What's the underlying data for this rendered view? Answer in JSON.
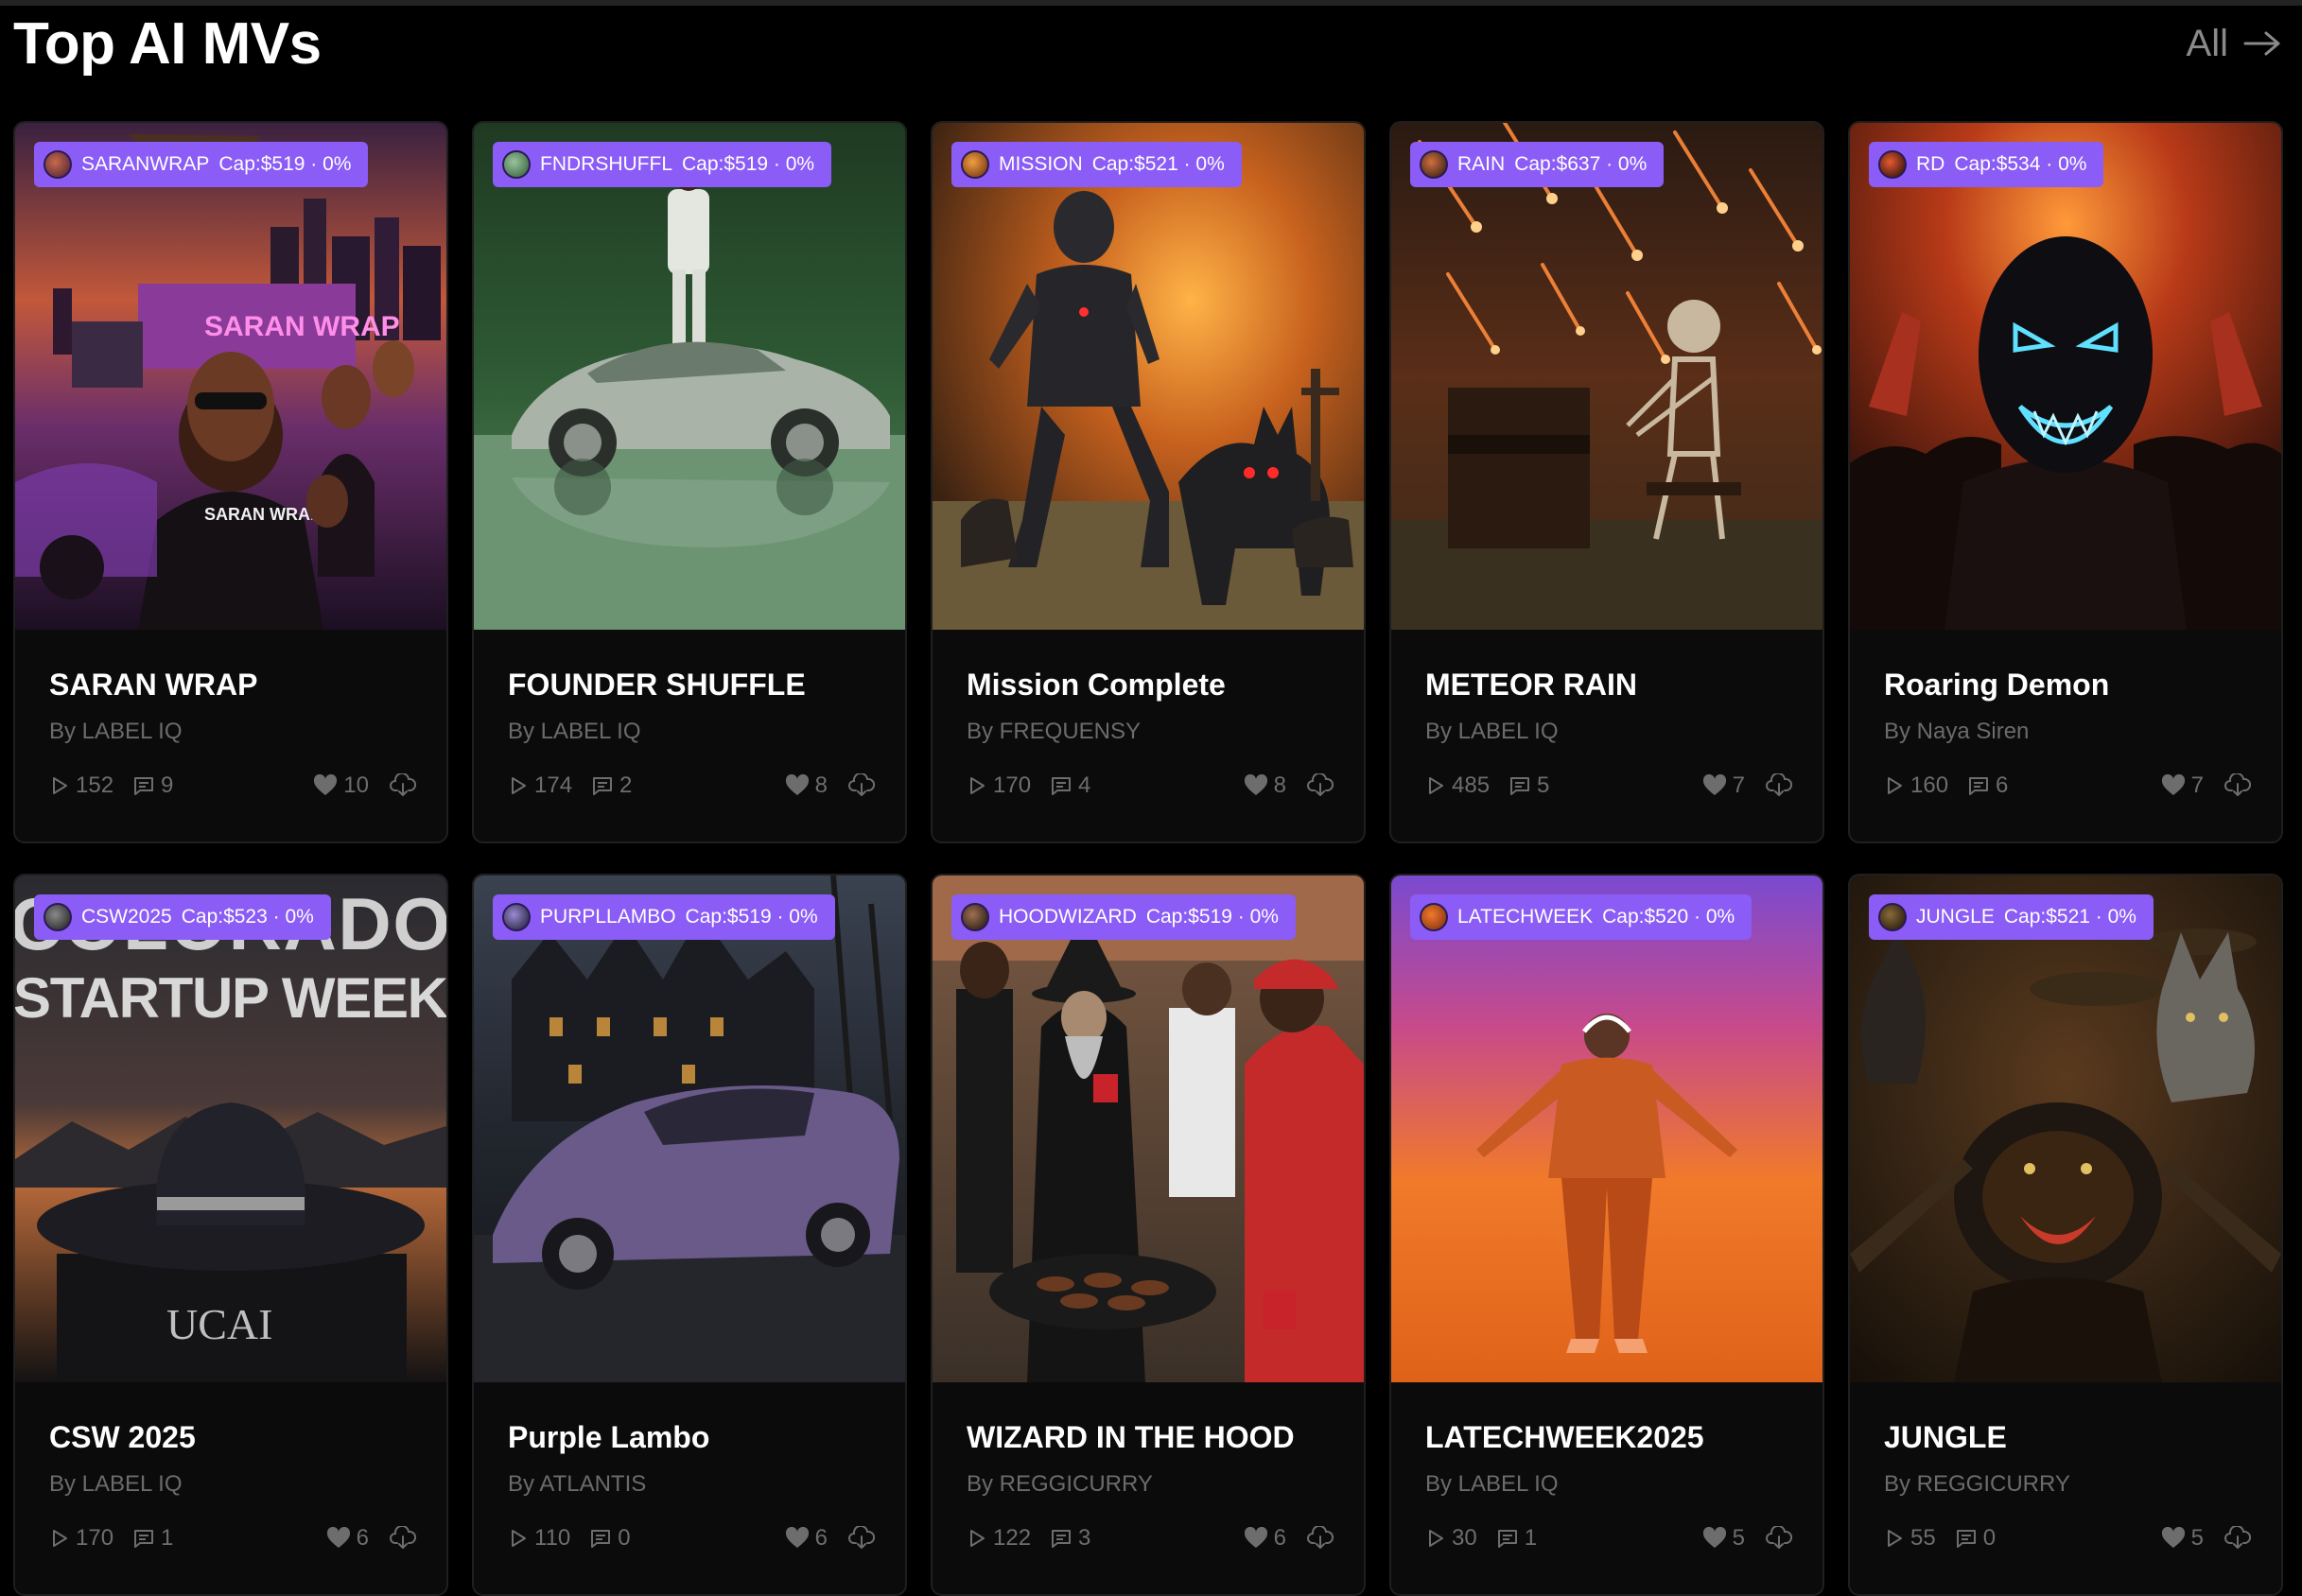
{
  "section": {
    "title": "Top AI MVs",
    "all_label": "All"
  },
  "colors": {
    "background": "#000000",
    "card": "#0b0b0b",
    "token_pill": "#8b5cf6",
    "muted_text": "#6b6b6b"
  },
  "cards": [
    {
      "title": "SARAN WRAP",
      "author": "By LABEL IQ",
      "token": "SARANWRAP",
      "cap": "Cap:$519 · 0%",
      "plays": "152",
      "comments": "9",
      "likes": "10"
    },
    {
      "title": "FOUNDER SHUFFLE",
      "author": "By LABEL IQ",
      "token": "FNDRSHUFFL",
      "cap": "Cap:$519 · 0%",
      "plays": "174",
      "comments": "2",
      "likes": "8"
    },
    {
      "title": "Mission Complete",
      "author": "By FREQUENSY",
      "token": "MISSION",
      "cap": "Cap:$521 · 0%",
      "plays": "170",
      "comments": "4",
      "likes": "8"
    },
    {
      "title": "METEOR RAIN",
      "author": "By LABEL IQ",
      "token": "RAIN",
      "cap": "Cap:$637 · 0%",
      "plays": "485",
      "comments": "5",
      "likes": "7"
    },
    {
      "title": "Roaring Demon",
      "author": "By Naya Siren",
      "token": "RD",
      "cap": "Cap:$534 · 0%",
      "plays": "160",
      "comments": "6",
      "likes": "7"
    },
    {
      "title": "CSW 2025",
      "author": "By LABEL IQ",
      "token": "CSW2025",
      "cap": "Cap:$523 · 0%",
      "plays": "170",
      "comments": "1",
      "likes": "6"
    },
    {
      "title": "Purple Lambo",
      "author": "By ATLANTIS",
      "token": "PURPLLAMBO",
      "cap": "Cap:$519 · 0%",
      "plays": "110",
      "comments": "0",
      "likes": "6"
    },
    {
      "title": "WIZARD IN THE HOOD",
      "author": "By REGGICURRY",
      "token": "HOODWIZARD",
      "cap": "Cap:$519 · 0%",
      "plays": "122",
      "comments": "3",
      "likes": "6"
    },
    {
      "title": "LATECHWEEK2025",
      "author": "By LABEL IQ",
      "token": "LATECHWEEK",
      "cap": "Cap:$520 · 0%",
      "plays": "30",
      "comments": "1",
      "likes": "5"
    },
    {
      "title": "JUNGLE",
      "author": "By REGGICURRY",
      "token": "JUNGLE",
      "cap": "Cap:$521 · 0%",
      "plays": "55",
      "comments": "0",
      "likes": "5"
    }
  ],
  "thumbnail_text": {
    "card1_truck": "SARAN WRAP",
    "card1_top": "SARAN\nWRAP",
    "card6_line1": "COLORADO",
    "card6_line2": "STARTUP WEEK",
    "card6_block": "UCAI"
  },
  "icons": {
    "all_arrow": "arrow-right-icon",
    "play": "play-icon",
    "comment": "comment-icon",
    "like": "heart-icon",
    "download": "download-icon"
  }
}
